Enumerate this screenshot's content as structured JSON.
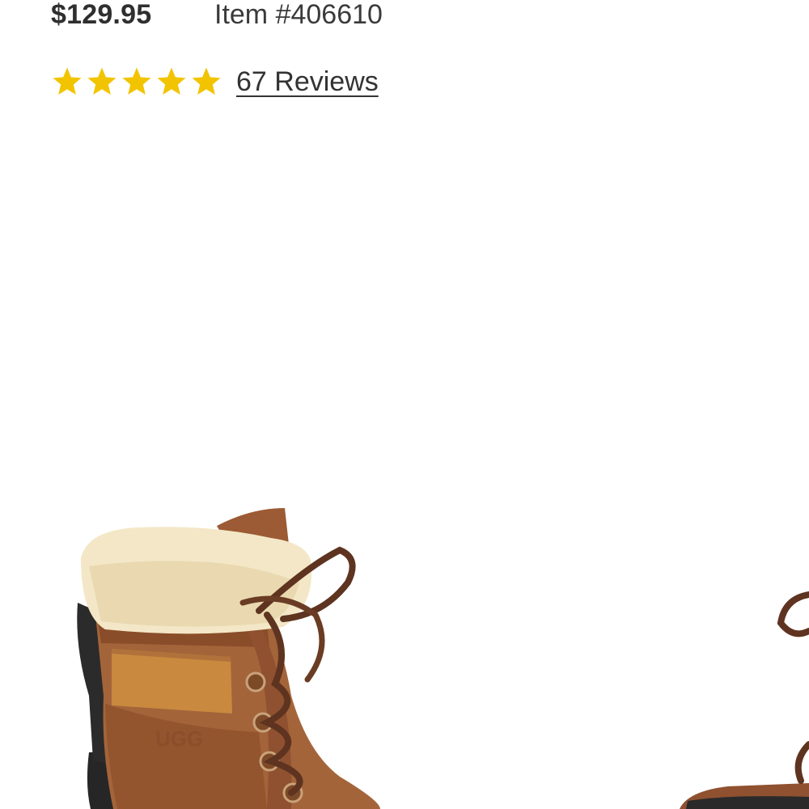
{
  "product": {
    "price": "$129.95",
    "item_number": "Item #406610",
    "rating": {
      "stars_filled": 5,
      "stars_total": 5,
      "reviews_label": "67 Reviews",
      "star_color": "#f2c400"
    },
    "image": {
      "subject": "brown leather lace-up boot with shearling cuff",
      "logo_text": "UGG"
    }
  }
}
